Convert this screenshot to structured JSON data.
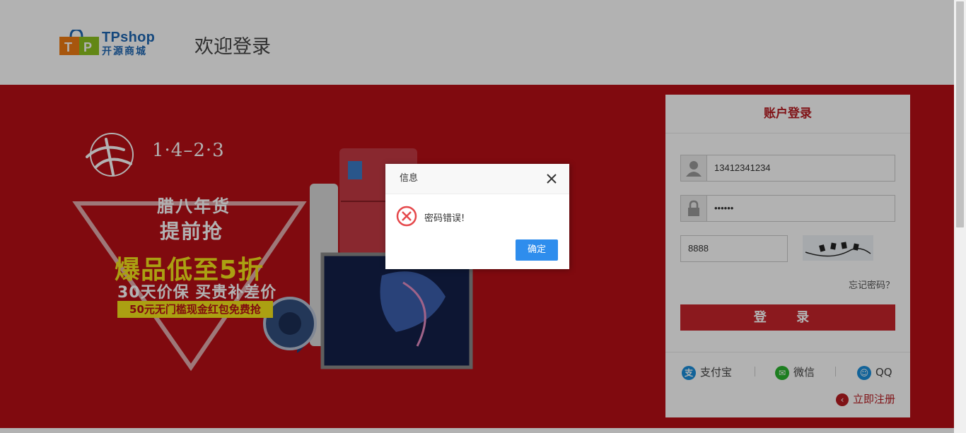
{
  "header": {
    "logo_title": "TPshop",
    "logo_subtitle": "开源商城",
    "welcome": "欢迎登录"
  },
  "banner": {
    "date": "1·4–2·3",
    "line1": "腊八年货",
    "line2": "提前抢",
    "line3": "爆品低至5折",
    "line4": "30天价保 买贵补差价",
    "line5": "50元无门槛现金红包免费抢"
  },
  "login": {
    "title": "账户登录",
    "username_value": "13412341234",
    "password_value": "••••••",
    "verify_code_value": "8888",
    "forgot_password": "忘记密码？",
    "login_button": "登 录",
    "social": {
      "alipay": "支付宝",
      "wechat": "微信",
      "qq": "QQ"
    },
    "register": "立即注册"
  },
  "dialog": {
    "title": "信息",
    "message": "密码错误!",
    "confirm": "确定"
  },
  "colors": {
    "brand_red": "#b81c22",
    "banner_red": "#b80f16",
    "dialog_button": "#2e8ded",
    "logo_blue": "#1f67b4"
  }
}
